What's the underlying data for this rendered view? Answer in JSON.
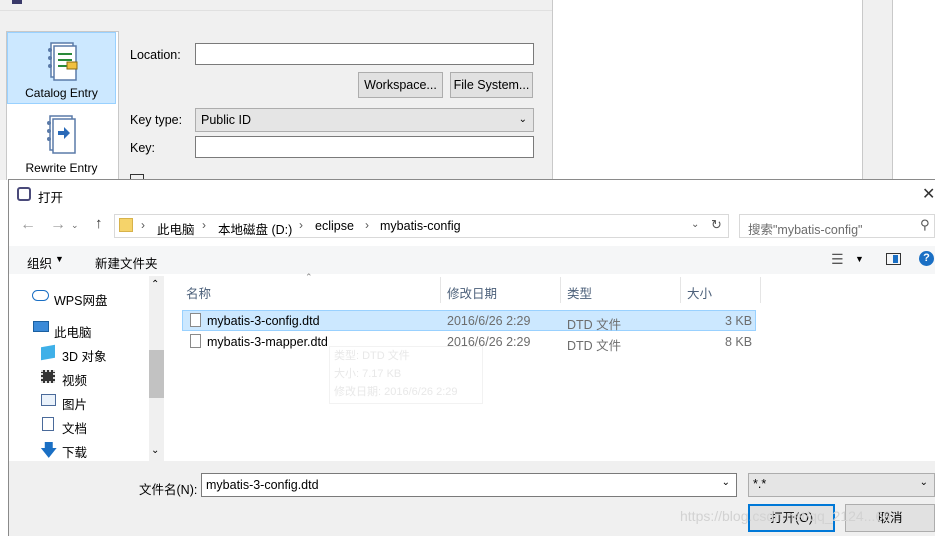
{
  "background_dialog": {
    "left_panel": [
      {
        "label": "Catalog Entry",
        "selected": true
      },
      {
        "label": "Rewrite Entry",
        "selected": false
      }
    ],
    "location_label": "Location:",
    "location_value": "",
    "workspace_button": "Workspace...",
    "filesystem_button": "File System...",
    "key_type_label": "Key type:",
    "key_type_value": "Public ID",
    "key_label": "Key:",
    "key_value": ""
  },
  "open_dialog": {
    "title": "打开",
    "breadcrumb": [
      "此电脑",
      "本地磁盘 (D:)",
      "eclipse",
      "mybatis-config"
    ],
    "search_placeholder": "搜索\"mybatis-config\"",
    "toolbar": {
      "organize": "组织",
      "new_folder": "新建文件夹"
    },
    "nav_items": [
      {
        "label": "WPS网盘",
        "icon": "cloud-icon"
      },
      {
        "label": "此电脑",
        "icon": "computer-icon"
      },
      {
        "label": "3D 对象",
        "icon": "cube-icon"
      },
      {
        "label": "视频",
        "icon": "video-icon"
      },
      {
        "label": "图片",
        "icon": "picture-icon"
      },
      {
        "label": "文档",
        "icon": "document-icon"
      },
      {
        "label": "下载",
        "icon": "download-icon"
      }
    ],
    "columns": [
      "名称",
      "修改日期",
      "类型",
      "大小"
    ],
    "files": [
      {
        "name": "mybatis-3-config.dtd",
        "date": "2016/6/26 2:29",
        "type": "DTD 文件",
        "size": "3 KB",
        "selected": true
      },
      {
        "name": "mybatis-3-mapper.dtd",
        "date": "2016/6/26 2:29",
        "type": "DTD 文件",
        "size": "8 KB",
        "selected": false
      }
    ],
    "tooltip": {
      "type": "类型: DTD 文件",
      "size": "大小: 7.17 KB",
      "modified": "修改日期: 2016/6/26 2:29"
    },
    "filename_label": "文件名(N):",
    "filename_value": "mybatis-3-config.dtd",
    "filetype_value": "*.*",
    "open_button": "打开(O)",
    "cancel_button": "取消"
  },
  "watermark": "https://blog.csdn.net/qq_2124...69",
  "colors": {
    "selection": "#cce8ff",
    "accent": "#0078d7",
    "folder": "#f5d36a"
  }
}
